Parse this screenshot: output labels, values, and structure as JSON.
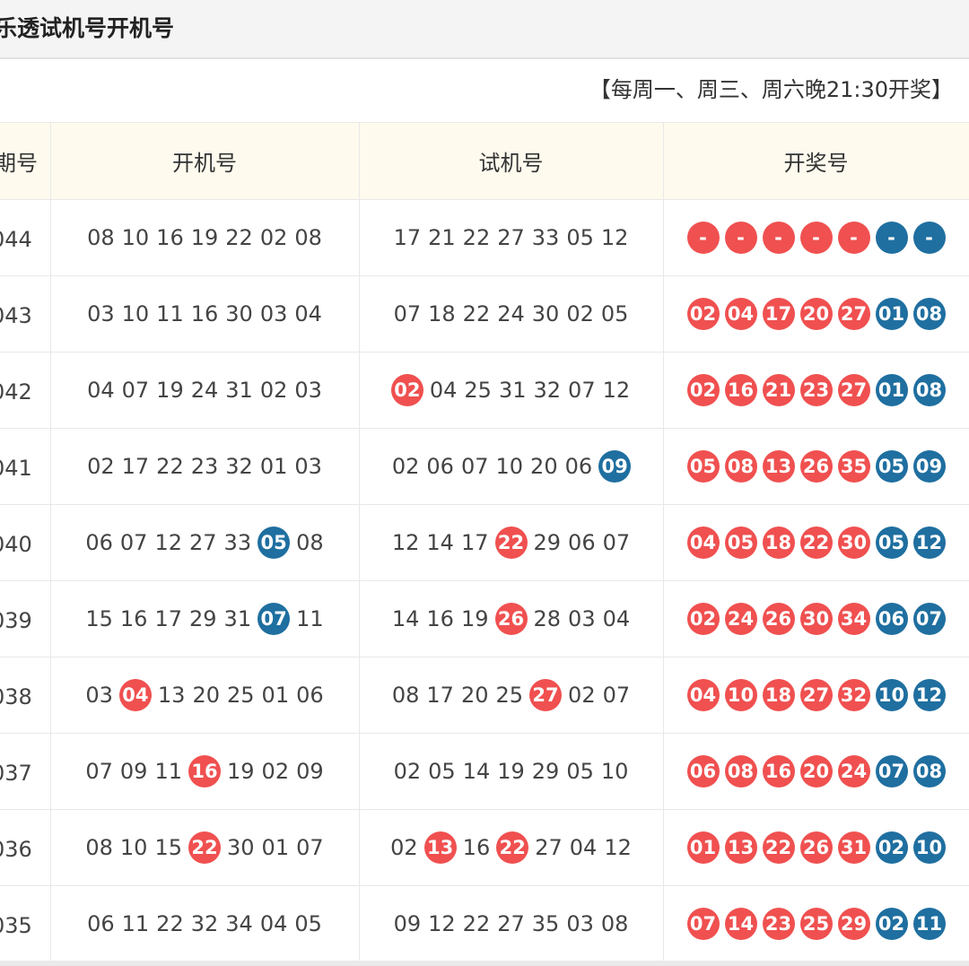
{
  "header": {
    "title": "乐透试机号开机号"
  },
  "notice": "【每周一、周三、周六晚21:30开奖】",
  "table": {
    "columns": [
      "期号",
      "开机号",
      "试机号",
      "开奖号"
    ],
    "rows": [
      {
        "issue": "044",
        "kaiji": [
          {
            "n": "08"
          },
          {
            "n": "10"
          },
          {
            "n": "16"
          },
          {
            "n": "19"
          },
          {
            "n": "22"
          },
          {
            "n": "02"
          },
          {
            "n": "08"
          }
        ],
        "shiji": [
          {
            "n": "17"
          },
          {
            "n": "21"
          },
          {
            "n": "22"
          },
          {
            "n": "27"
          },
          {
            "n": "33"
          },
          {
            "n": "05"
          },
          {
            "n": "12"
          }
        ],
        "prize": [
          "-",
          "-",
          "-",
          "-",
          "-",
          "-",
          "-"
        ]
      },
      {
        "issue": "043",
        "kaiji": [
          {
            "n": "03"
          },
          {
            "n": "10"
          },
          {
            "n": "11"
          },
          {
            "n": "16"
          },
          {
            "n": "30"
          },
          {
            "n": "03"
          },
          {
            "n": "04"
          }
        ],
        "shiji": [
          {
            "n": "07"
          },
          {
            "n": "18"
          },
          {
            "n": "22"
          },
          {
            "n": "24"
          },
          {
            "n": "30"
          },
          {
            "n": "02"
          },
          {
            "n": "05"
          }
        ],
        "prize": [
          "02",
          "04",
          "17",
          "20",
          "27",
          "01",
          "08"
        ]
      },
      {
        "issue": "042",
        "kaiji": [
          {
            "n": "04"
          },
          {
            "n": "07"
          },
          {
            "n": "19"
          },
          {
            "n": "24"
          },
          {
            "n": "31"
          },
          {
            "n": "02"
          },
          {
            "n": "03"
          }
        ],
        "shiji": [
          {
            "n": "02",
            "hit": "red"
          },
          {
            "n": "04"
          },
          {
            "n": "25"
          },
          {
            "n": "31"
          },
          {
            "n": "32"
          },
          {
            "n": "07"
          },
          {
            "n": "12"
          }
        ],
        "prize": [
          "02",
          "16",
          "21",
          "23",
          "27",
          "01",
          "08"
        ]
      },
      {
        "issue": "041",
        "kaiji": [
          {
            "n": "02"
          },
          {
            "n": "17"
          },
          {
            "n": "22"
          },
          {
            "n": "23"
          },
          {
            "n": "32"
          },
          {
            "n": "01"
          },
          {
            "n": "03"
          }
        ],
        "shiji": [
          {
            "n": "02"
          },
          {
            "n": "06"
          },
          {
            "n": "07"
          },
          {
            "n": "10"
          },
          {
            "n": "20"
          },
          {
            "n": "06"
          },
          {
            "n": "09",
            "hit": "blue"
          }
        ],
        "prize": [
          "05",
          "08",
          "13",
          "26",
          "35",
          "05",
          "09"
        ]
      },
      {
        "issue": "040",
        "kaiji": [
          {
            "n": "06"
          },
          {
            "n": "07"
          },
          {
            "n": "12"
          },
          {
            "n": "27"
          },
          {
            "n": "33"
          },
          {
            "n": "05",
            "hit": "blue"
          },
          {
            "n": "08"
          }
        ],
        "shiji": [
          {
            "n": "12"
          },
          {
            "n": "14"
          },
          {
            "n": "17"
          },
          {
            "n": "22",
            "hit": "red"
          },
          {
            "n": "29"
          },
          {
            "n": "06"
          },
          {
            "n": "07"
          }
        ],
        "prize": [
          "04",
          "05",
          "18",
          "22",
          "30",
          "05",
          "12"
        ]
      },
      {
        "issue": "039",
        "kaiji": [
          {
            "n": "15"
          },
          {
            "n": "16"
          },
          {
            "n": "17"
          },
          {
            "n": "29"
          },
          {
            "n": "31"
          },
          {
            "n": "07",
            "hit": "blue"
          },
          {
            "n": "11"
          }
        ],
        "shiji": [
          {
            "n": "14"
          },
          {
            "n": "16"
          },
          {
            "n": "19"
          },
          {
            "n": "26",
            "hit": "red"
          },
          {
            "n": "28"
          },
          {
            "n": "03"
          },
          {
            "n": "04"
          }
        ],
        "prize": [
          "02",
          "24",
          "26",
          "30",
          "34",
          "06",
          "07"
        ]
      },
      {
        "issue": "038",
        "kaiji": [
          {
            "n": "03"
          },
          {
            "n": "04",
            "hit": "red"
          },
          {
            "n": "13"
          },
          {
            "n": "20"
          },
          {
            "n": "25"
          },
          {
            "n": "01"
          },
          {
            "n": "06"
          }
        ],
        "shiji": [
          {
            "n": "08"
          },
          {
            "n": "17"
          },
          {
            "n": "20"
          },
          {
            "n": "25"
          },
          {
            "n": "27",
            "hit": "red"
          },
          {
            "n": "02"
          },
          {
            "n": "07"
          }
        ],
        "prize": [
          "04",
          "10",
          "18",
          "27",
          "32",
          "10",
          "12"
        ]
      },
      {
        "issue": "037",
        "kaiji": [
          {
            "n": "07"
          },
          {
            "n": "09"
          },
          {
            "n": "11"
          },
          {
            "n": "16",
            "hit": "red"
          },
          {
            "n": "19"
          },
          {
            "n": "02"
          },
          {
            "n": "09"
          }
        ],
        "shiji": [
          {
            "n": "02"
          },
          {
            "n": "05"
          },
          {
            "n": "14"
          },
          {
            "n": "19"
          },
          {
            "n": "29"
          },
          {
            "n": "05"
          },
          {
            "n": "10"
          }
        ],
        "prize": [
          "06",
          "08",
          "16",
          "20",
          "24",
          "07",
          "08"
        ]
      },
      {
        "issue": "036",
        "kaiji": [
          {
            "n": "08"
          },
          {
            "n": "10"
          },
          {
            "n": "15"
          },
          {
            "n": "22",
            "hit": "red"
          },
          {
            "n": "30"
          },
          {
            "n": "01"
          },
          {
            "n": "07"
          }
        ],
        "shiji": [
          {
            "n": "02"
          },
          {
            "n": "13",
            "hit": "red"
          },
          {
            "n": "16"
          },
          {
            "n": "22",
            "hit": "red"
          },
          {
            "n": "27"
          },
          {
            "n": "04"
          },
          {
            "n": "12"
          }
        ],
        "prize": [
          "01",
          "13",
          "22",
          "26",
          "31",
          "02",
          "10"
        ]
      },
      {
        "issue": "035",
        "kaiji": [
          {
            "n": "06"
          },
          {
            "n": "11"
          },
          {
            "n": "22"
          },
          {
            "n": "32"
          },
          {
            "n": "34"
          },
          {
            "n": "04"
          },
          {
            "n": "05"
          }
        ],
        "shiji": [
          {
            "n": "09"
          },
          {
            "n": "12"
          },
          {
            "n": "22"
          },
          {
            "n": "27"
          },
          {
            "n": "35"
          },
          {
            "n": "03"
          },
          {
            "n": "08"
          }
        ],
        "prize": [
          "07",
          "14",
          "23",
          "25",
          "29",
          "02",
          "11"
        ]
      }
    ]
  },
  "colors": {
    "red_ball": "#f05050",
    "blue_ball": "#1f6fa0",
    "header_bg": "#fefaee"
  }
}
